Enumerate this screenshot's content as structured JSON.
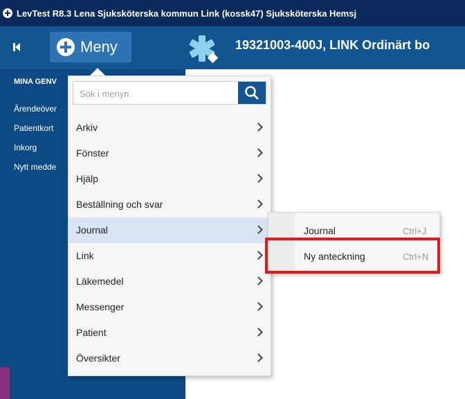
{
  "window": {
    "title": "LevTest R8.3 Lena Sjuksköterska kommun Link (kossk47) Sjuksköterska Hemsj"
  },
  "toolbar": {
    "menu_label": "Meny",
    "patient_text": "19321003-400J,  LINK Ordinärt bo"
  },
  "sidebar": {
    "heading": "MINA GENV",
    "items": [
      {
        "label": "Ärendeöver"
      },
      {
        "label": "Patientkort"
      },
      {
        "label": "Inkorg"
      },
      {
        "label": "Nytt medde"
      }
    ]
  },
  "menu": {
    "search_placeholder": "Sök i menyn",
    "items": [
      {
        "label": "Arkiv",
        "has_submenu": true
      },
      {
        "label": "Fönster",
        "has_submenu": true
      },
      {
        "label": "Hjälp",
        "has_submenu": true
      },
      {
        "label": "Beställning och svar",
        "has_submenu": true
      },
      {
        "label": "Journal",
        "has_submenu": true,
        "active": true
      },
      {
        "label": "Link",
        "has_submenu": true
      },
      {
        "label": "Läkemedel",
        "has_submenu": true
      },
      {
        "label": "Messenger",
        "has_submenu": true
      },
      {
        "label": "Patient",
        "has_submenu": true
      },
      {
        "label": "Översikter",
        "has_submenu": true
      }
    ]
  },
  "submenu": {
    "items": [
      {
        "label": "Journal",
        "shortcut": "Ctrl+J"
      },
      {
        "label": "Ny anteckning",
        "shortcut": "Ctrl+N",
        "highlighted": true
      }
    ]
  },
  "colors": {
    "title_bar": "#0a2a5c",
    "toolbar": "#135591",
    "menu_button": "#2e74b5",
    "sidebar": "#0d4a85",
    "highlight_border": "#e0191f",
    "active_item": "#d8e4f3"
  },
  "icons": [
    "app-plus-icon",
    "collapse-sidebar-icon",
    "menu-plus-icon",
    "star-of-life-icon",
    "search-icon",
    "chevron-right-icon"
  ]
}
